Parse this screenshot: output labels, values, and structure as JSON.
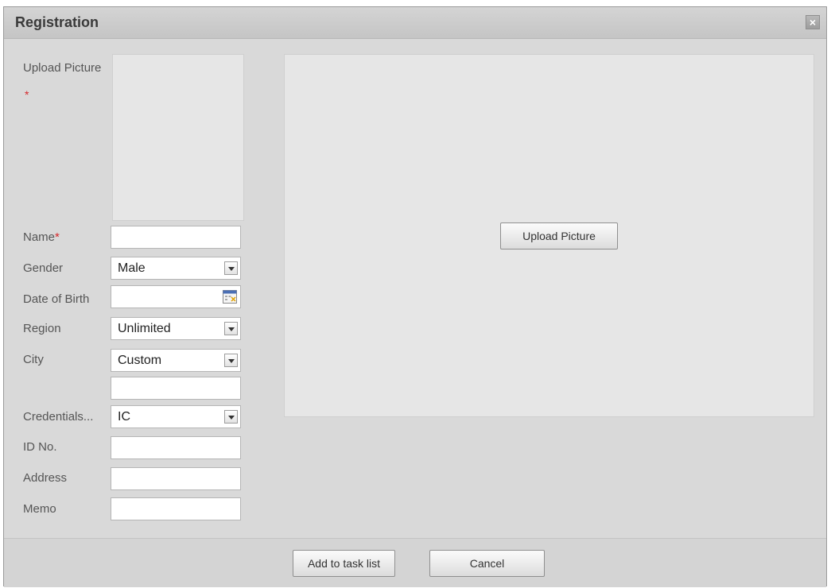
{
  "dialog": {
    "title": "Registration",
    "close_label": "×"
  },
  "form": {
    "upload_picture_label": "Upload Picture",
    "required_mark": "*",
    "name_label": "Name",
    "name_value": "",
    "gender_label": "Gender",
    "gender_value": "Male",
    "dob_label": "Date of Birth",
    "dob_value": "",
    "region_label": "Region",
    "region_value": "Unlimited",
    "city_label": "City",
    "city_value": "Custom",
    "city_custom_value": "",
    "credentials_label": "Credentials...",
    "credentials_value": "IC",
    "id_label": "ID No.",
    "id_value": "",
    "address_label": "Address",
    "address_value": "",
    "memo_label": "Memo",
    "memo_value": ""
  },
  "preview": {
    "upload_button_label": "Upload Picture"
  },
  "footer": {
    "add_button_label": "Add to task list",
    "cancel_button_label": "Cancel"
  },
  "icons": {
    "close": "close-icon",
    "dropdown": "chevron-down-icon",
    "calendar": "calendar-icon"
  },
  "colors": {
    "required": "#d6282b",
    "background": "#d9d9d9",
    "panel": "#e6e6e6"
  }
}
